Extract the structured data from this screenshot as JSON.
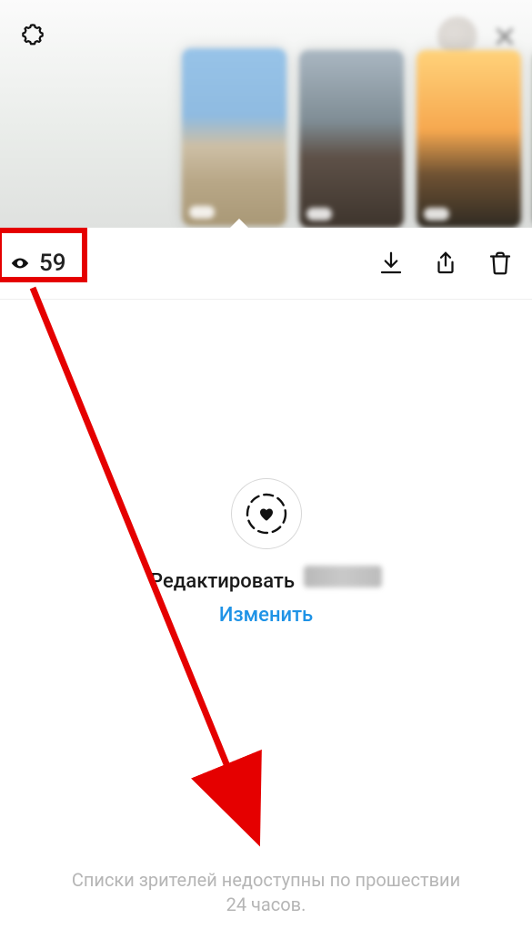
{
  "header": {
    "settings_icon": "gear-icon",
    "close_icon": "close-icon"
  },
  "stories": {
    "thumbs": [
      {
        "id": "t1"
      },
      {
        "id": "t2"
      },
      {
        "id": "t3"
      },
      {
        "id": "t4"
      }
    ]
  },
  "toolbar": {
    "views_count": "59",
    "download_icon": "download-icon",
    "share_icon": "share-icon",
    "trash_icon": "trash-icon",
    "eye_icon": "eye-icon"
  },
  "highlight": {
    "edit_label": "Редактировать",
    "change_link": "Изменить"
  },
  "footer": {
    "note_line1": "Списки зрителей недоступны по прошествии",
    "note_line2": "24 часов."
  },
  "annotation": {
    "color": "#e50000"
  }
}
